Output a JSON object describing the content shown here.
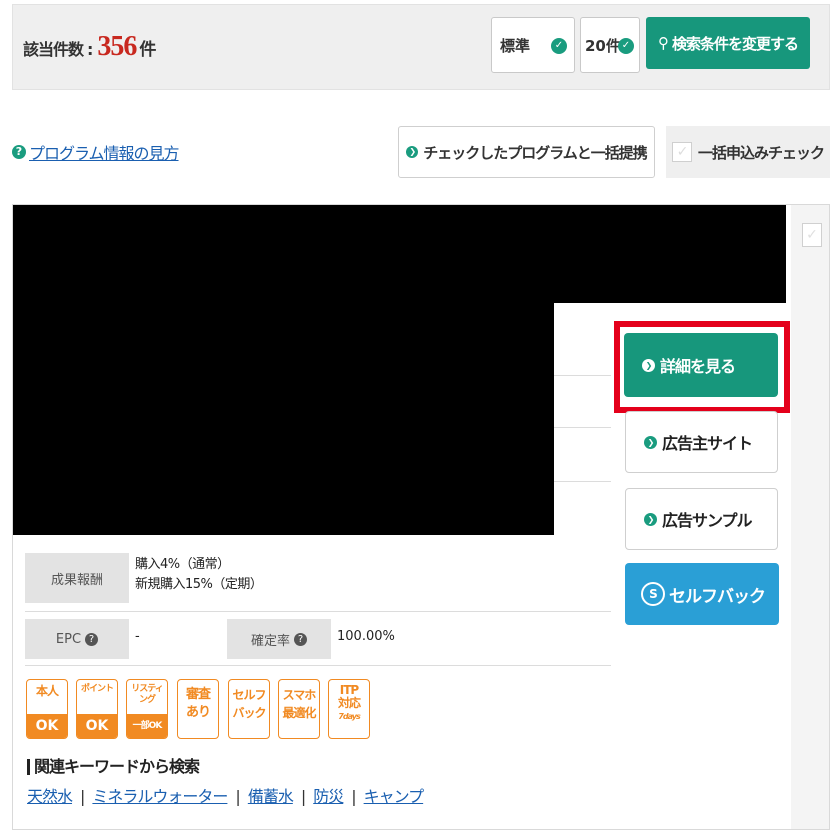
{
  "search": {
    "count_label": "該当件数",
    "colon": ":",
    "count": "356",
    "count_unit": "件",
    "sort_value": "標準",
    "per_page_value": "20件",
    "change_button": "検索条件を変更する"
  },
  "toolbar": {
    "help_link": "プログラム情報の見方",
    "bulk_propose_button": "チェックしたプログラムと一括提携",
    "bulk_apply_check": "一括申込みチェック"
  },
  "program": {
    "detail_button": "詳細を見る",
    "advertiser_site_button": "広告主サイト",
    "ad_sample_button": "広告サンプル",
    "selfback_button": "セルフバック",
    "reward_label": "成果報酬",
    "reward_lines": [
      "購入4%（通常）",
      "新規購入15%（定期）"
    ],
    "epc_label": "EPC",
    "epc_value": "-",
    "confirm_rate_label": "確定率",
    "confirm_rate_value": "100.00%",
    "badges": {
      "honnin_top": "本人",
      "honnin_bottom": "OK",
      "point_top": "ポイント",
      "point_bottom": "OK",
      "listing_top": "リスティング",
      "listing_bottom": "一部OK",
      "shinsa": "審査あり",
      "selfback": "セルフバック",
      "smartphone": "スマホ最適化",
      "itp_top": "ITP",
      "itp_mid": "対応",
      "itp_days": "7days"
    },
    "keywords_title": "関連キーワードから検索",
    "keywords": [
      "天然水",
      "ミネラルウォーター",
      "備蓄水",
      "防災",
      "キャンプ"
    ],
    "keyword_separator": "|"
  },
  "colors": {
    "accent_green": "#17977c",
    "count_red": "#c8281f",
    "highlight_red": "#e4001b",
    "badge_orange": "#f18a22",
    "selfback_blue": "#2a9fd6"
  },
  "icons": {
    "check": "check-icon",
    "chevron": "chevron-down-icon",
    "search": "search-icon",
    "arrow": "arrow-right-circle-icon",
    "question": "question-circle-icon",
    "selfback": "selfback-s-icon"
  }
}
